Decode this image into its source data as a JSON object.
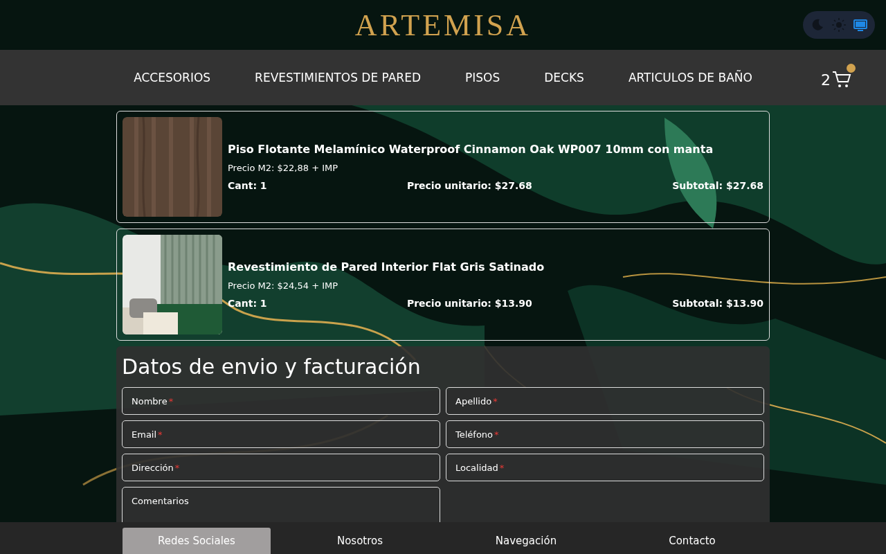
{
  "header": {
    "logo": "ARTEMISA",
    "theme_options": [
      {
        "kind": "dark",
        "selected": false
      },
      {
        "kind": "light",
        "selected": false
      },
      {
        "kind": "system",
        "selected": true
      }
    ]
  },
  "nav": {
    "items": [
      "ACCESORIOS",
      "REVESTIMIENTOS DE PARED",
      "PISOS",
      "DECKS",
      "ARTICULOS DE BAÑO"
    ],
    "cart_count": "2",
    "cart_badge": true
  },
  "cart_items": [
    {
      "name": "Piso Flotante Melamínico Waterproof Cinnamon Oak WP007 10mm con manta",
      "price_m2": "Precio M2: $22,88 + IMP",
      "quantity": "Cant: 1",
      "unit_price": "Precio unitario: $27.68",
      "subtotal": "Subtotal: $27.68"
    },
    {
      "name": "Revestimiento de Pared Interior Flat Gris Satinado",
      "price_m2": "Precio M2: $24,54 + IMP",
      "quantity": "Cant: 1",
      "unit_price": "Precio unitario: $13.90",
      "subtotal": "Subtotal: $13.90"
    }
  ],
  "form": {
    "title": "Datos de envio y facturación",
    "fields": [
      {
        "label": "Nombre",
        "required_mark": "*"
      },
      {
        "label": "Apellido",
        "required_mark": "*"
      },
      {
        "label": "Email",
        "required_mark": "*"
      },
      {
        "label": "Teléfono",
        "required_mark": "*"
      },
      {
        "label": "Dirección",
        "required_mark": "*"
      },
      {
        "label": "Localidad",
        "required_mark": "*"
      },
      {
        "label": "Comentarios"
      }
    ]
  },
  "footer_tabs": [
    {
      "label": "Redes Sociales",
      "selected": true
    },
    {
      "label": "Nosotros",
      "selected": false
    },
    {
      "label": "Navegación",
      "selected": false
    },
    {
      "label": "Contacto",
      "selected": false
    }
  ]
}
